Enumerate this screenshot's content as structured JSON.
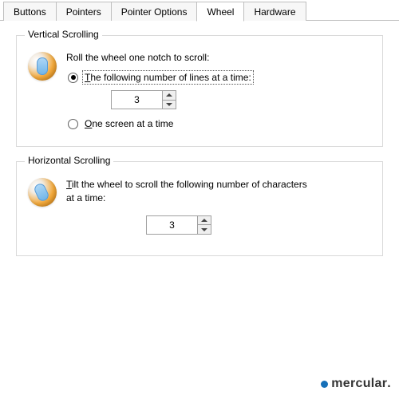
{
  "tabs": {
    "buttons": "Buttons",
    "pointers": "Pointers",
    "options": "Pointer Options",
    "wheel": "Wheel",
    "hardware": "Hardware"
  },
  "vertical": {
    "legend": "Vertical Scrolling",
    "instruction": "Roll the wheel one notch to scroll:",
    "radio_lines_prefix": "T",
    "radio_lines_rest": "he following number of lines at a time:",
    "radio_screen_prefix": "O",
    "radio_screen_rest": "ne screen at a time",
    "value": "3"
  },
  "horizontal": {
    "legend": "Horizontal Scrolling",
    "text_prefix": "T",
    "text_rest": "ilt the wheel to scroll the following number of characters at a time:",
    "value": "3"
  },
  "watermark": {
    "brand": "mercular",
    "suffix": "."
  }
}
